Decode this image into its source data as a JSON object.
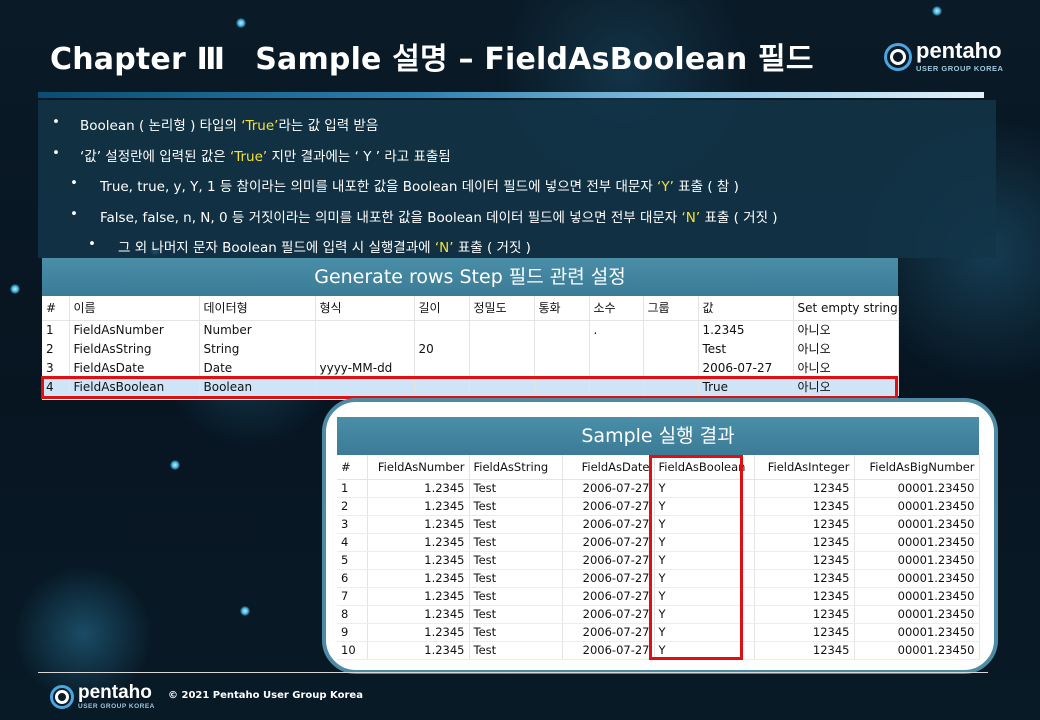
{
  "title": {
    "part1": "Chapter Ⅲ",
    "part2": "Sample 설명 – FieldAsBoolean 필드"
  },
  "logo": {
    "name": "pentaho",
    "sub": "USER GROUP KOREA"
  },
  "bullets": [
    {
      "level": 1,
      "segments": [
        {
          "t": "Boolean ( 논리형 ) 타입의 "
        },
        {
          "t": "‘True’",
          "hl": true
        },
        {
          "t": "라는 값 입력 받음"
        }
      ]
    },
    {
      "level": 1,
      "segments": [
        {
          "t": "‘값’ 설정란에 입력된 값은 "
        },
        {
          "t": "‘True’",
          "hl": true
        },
        {
          "t": " 지만 결과에는 ‘ Y ’ 라고 표출됨"
        }
      ]
    },
    {
      "level": 2,
      "segments": [
        {
          "t": "True, true, y, Y, 1 등 참이라는 의미를 내포한 값을 Boolean 데이터 필드에 넣으면 전부 대문자 "
        },
        {
          "t": "‘Y’",
          "hl": true
        },
        {
          "t": " 표출 ( 참 )"
        }
      ]
    },
    {
      "level": 2,
      "segments": [
        {
          "t": "False, false, n, N, 0 등 거짓이라는 의미를 내포한 값을 Boolean 데이터 필드에 넣으면 전부 대문자 "
        },
        {
          "t": "‘N’",
          "hl": true
        },
        {
          "t": " 표출 ( 거짓 )"
        }
      ]
    },
    {
      "level": 3,
      "segments": [
        {
          "t": "그 외 나머지 문자 Boolean 필드에 입력 시 실행결과에 "
        },
        {
          "t": "‘N’",
          "hl": true
        },
        {
          "t": " 표출 ( 거짓 )"
        }
      ]
    }
  ],
  "generate_rows": {
    "title": "Generate rows Step 필드 관련 설정",
    "headers": [
      "#",
      "이름",
      "데이터형",
      "형식",
      "길이",
      "정밀도",
      "통화",
      "소수",
      "그룹",
      "값",
      "Set empty string?"
    ],
    "rows": [
      [
        "1",
        "FieldAsNumber",
        "Number",
        "",
        "",
        "",
        "",
        ".",
        "",
        "1.2345",
        "아니오"
      ],
      [
        "2",
        "FieldAsString",
        "String",
        "",
        "20",
        "",
        "",
        "",
        "",
        "Test",
        "아니오"
      ],
      [
        "3",
        "FieldAsDate",
        "Date",
        "yyyy-MM-dd",
        "",
        "",
        "",
        "",
        "",
        "2006-07-27",
        "아니오"
      ],
      [
        "4",
        "FieldAsBoolean",
        "Boolean",
        "",
        "",
        "",
        "",
        "",
        "",
        "True",
        "아니오"
      ]
    ],
    "selected_row": 4
  },
  "sample_result": {
    "title": "Sample 실행 결과",
    "headers": [
      "#",
      "FieldAsNumber",
      "FieldAsString",
      "FieldAsDate",
      "FieldAsBoolean",
      "FieldAsInteger",
      "FieldAsBigNumber"
    ],
    "rows": [
      [
        "1",
        "1.2345",
        "Test",
        "2006-07-27",
        "Y",
        "12345",
        "00001.23450"
      ],
      [
        "2",
        "1.2345",
        "Test",
        "2006-07-27",
        "Y",
        "12345",
        "00001.23450"
      ],
      [
        "3",
        "1.2345",
        "Test",
        "2006-07-27",
        "Y",
        "12345",
        "00001.23450"
      ],
      [
        "4",
        "1.2345",
        "Test",
        "2006-07-27",
        "Y",
        "12345",
        "00001.23450"
      ],
      [
        "5",
        "1.2345",
        "Test",
        "2006-07-27",
        "Y",
        "12345",
        "00001.23450"
      ],
      [
        "6",
        "1.2345",
        "Test",
        "2006-07-27",
        "Y",
        "12345",
        "00001.23450"
      ],
      [
        "7",
        "1.2345",
        "Test",
        "2006-07-27",
        "Y",
        "12345",
        "00001.23450"
      ],
      [
        "8",
        "1.2345",
        "Test",
        "2006-07-27",
        "Y",
        "12345",
        "00001.23450"
      ],
      [
        "9",
        "1.2345",
        "Test",
        "2006-07-27",
        "Y",
        "12345",
        "00001.23450"
      ],
      [
        "10",
        "1.2345",
        "Test",
        "2006-07-27",
        "Y",
        "12345",
        "00001.23450"
      ]
    ]
  },
  "footer": {
    "copyright": "© 2021 Pentaho User Group Korea"
  },
  "colors": {
    "highlight": "#f3e03a",
    "panel_header": "#3b7b96",
    "red_box": "#e01010",
    "selected_row": "#cfe5f7"
  }
}
